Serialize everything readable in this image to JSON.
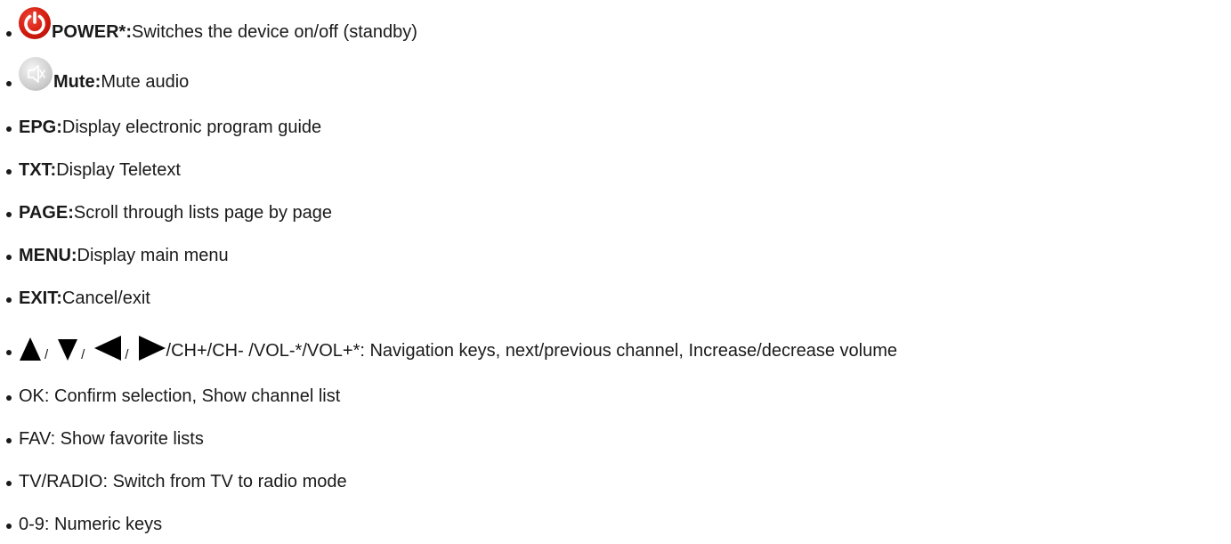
{
  "items": [
    {
      "term": "POWER*:",
      "desc": " Switches the device on/off (standby)",
      "icon": "power-icon"
    },
    {
      "term": "Mute:",
      "desc": " Mute audio",
      "icon": "mute-icon"
    },
    {
      "term": "EPG:",
      "desc": " Display electronic program guide"
    },
    {
      "term": "TXT:",
      "desc": " Display Teletext"
    },
    {
      "term": "PAGE:",
      "desc": " Scroll through lists page by page"
    },
    {
      "term": "MENU:",
      "desc": " Display main menu"
    },
    {
      "term": "EXIT:",
      "desc": " Cancel/exit"
    }
  ],
  "nav": {
    "icons": [
      "arrow-up-icon",
      "arrow-down-icon",
      "arrow-left-icon",
      "arrow-right-icon"
    ],
    "separator": "/",
    "text": "/CH+/CH- /VOL-*/VOL+*: Navigation keys, next/previous channel, Increase/decrease volume"
  },
  "plain_items": [
    "OK: Confirm selection, Show channel list",
    "FAV: Show favorite lists",
    "TV/RADIO: Switch from TV to radio mode",
    "0-9: Numeric keys"
  ],
  "colors": {
    "power_red": "#d21a0e",
    "text": "#1a1a1a",
    "mute_grey": "#cfcfcf"
  }
}
